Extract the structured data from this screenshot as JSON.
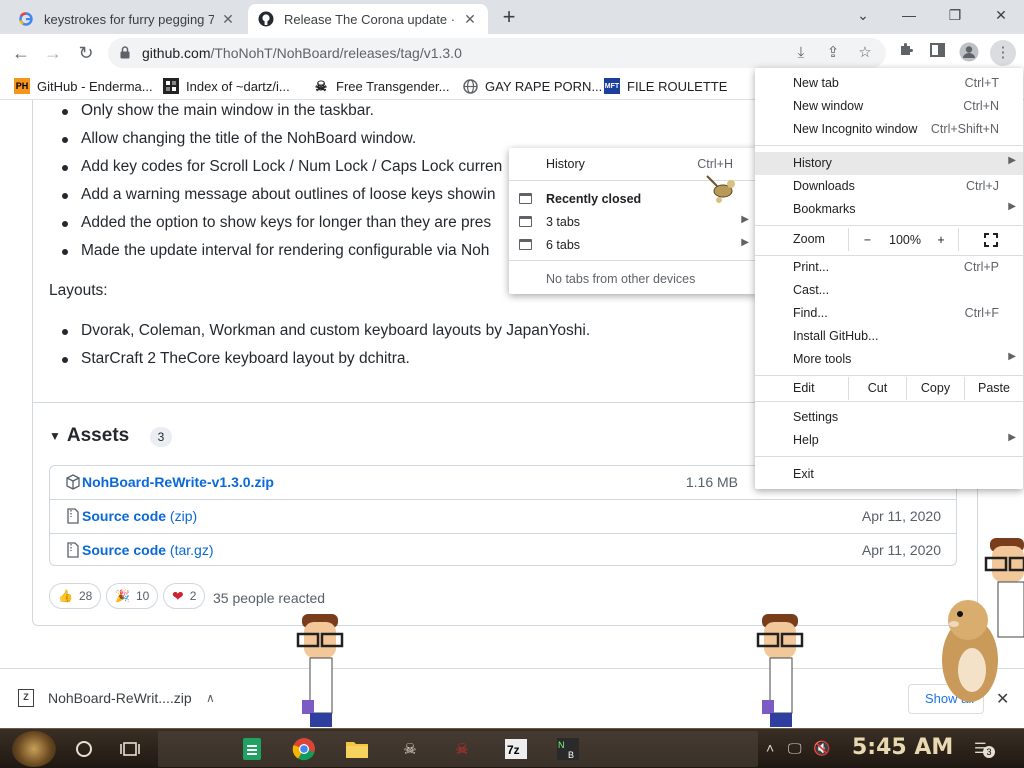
{
  "browser": {
    "tabs": [
      {
        "title": "keystrokes for furry pegging 7",
        "favicon": "google-icon"
      },
      {
        "title": "Release The Corona update · Th",
        "favicon": "github-icon"
      }
    ],
    "new_tab_symbol": "+",
    "window_controls": {
      "minimize": "⌄",
      "minimize2": "—",
      "restore": "❐",
      "close": "✕"
    },
    "url_host": "github.com",
    "url_path": "/ThoNohT/NohBoard/releases/tag/v1.3.0"
  },
  "bookmarks": [
    {
      "label": "GitHub - Enderma...",
      "icon": "PH"
    },
    {
      "label": "Index of ~dartz/i...",
      "icon": "pixel-icon"
    },
    {
      "label": "Free Transgender...",
      "icon": "skull-icon"
    },
    {
      "label": "GAY RAPE PORN...",
      "icon": "globe-icon"
    },
    {
      "label": "FILE ROULETTE",
      "icon": "MFT"
    }
  ],
  "release": {
    "bullets_top": [
      "Only show the main window in the taskbar.",
      "Allow changing the title of the NohBoard window.",
      "Add key codes for Scroll Lock / Num Lock / Caps Lock curren",
      "Add a warning message about outlines of loose keys showin",
      "Added the option to show keys for longer than they are pres",
      "Made the update interval for rendering configurable via Noh"
    ],
    "layouts_heading": "Layouts:",
    "bullets_layouts": [
      "Dvorak, Coleman, Workman and custom keyboard layouts by JapanYoshi.",
      "StarCraft 2 TheCore keyboard layout by dchitra."
    ]
  },
  "assets": {
    "heading": "Assets",
    "count": "3",
    "items": [
      {
        "name": "NohBoard-ReWrite-v1.3.0.zip",
        "suffix": "",
        "meta": "1.16 MB"
      },
      {
        "name": "Source code",
        "suffix": "(zip)",
        "meta": "Apr 11, 2020"
      },
      {
        "name": "Source code",
        "suffix": "(tar.gz)",
        "meta": "Apr 11, 2020"
      }
    ]
  },
  "reactions": [
    {
      "emoji": "👍",
      "count": "28"
    },
    {
      "emoji": "🎉",
      "count": "10"
    },
    {
      "emoji": "❤",
      "count": "2"
    }
  ],
  "reactions_summary": "35 people reacted",
  "chrome_menu": {
    "new_tab": {
      "label": "New tab",
      "shortcut": "Ctrl+T"
    },
    "new_window": {
      "label": "New window",
      "shortcut": "Ctrl+N"
    },
    "new_incognito": {
      "label": "New Incognito window",
      "shortcut": "Ctrl+Shift+N"
    },
    "history": {
      "label": "History"
    },
    "downloads": {
      "label": "Downloads",
      "shortcut": "Ctrl+J"
    },
    "bookmarks": {
      "label": "Bookmarks"
    },
    "zoom": {
      "label": "Zoom",
      "minus": "−",
      "value": "100%",
      "plus": "+"
    },
    "print": {
      "label": "Print...",
      "shortcut": "Ctrl+P"
    },
    "cast": {
      "label": "Cast..."
    },
    "find": {
      "label": "Find...",
      "shortcut": "Ctrl+F"
    },
    "install": {
      "label": "Install GitHub..."
    },
    "more_tools": {
      "label": "More tools"
    },
    "edit": {
      "label": "Edit",
      "cut": "Cut",
      "copy": "Copy",
      "paste": "Paste"
    },
    "settings": {
      "label": "Settings"
    },
    "help": {
      "label": "Help"
    },
    "exit": {
      "label": "Exit"
    }
  },
  "history_submenu": {
    "history": {
      "label": "History",
      "shortcut": "Ctrl+H"
    },
    "recently_closed": "Recently closed",
    "three_tabs": "3 tabs",
    "six_tabs": "6 tabs",
    "no_tabs": "No tabs from other devices"
  },
  "download_bar": {
    "file": "NohBoard-ReWrit....zip",
    "show_all": "Show all"
  },
  "taskbar": {
    "clock": "5:45 AM",
    "notification_count": "3"
  },
  "colors": {
    "link": "#0969da",
    "menu_highlight": "#e8e8e9",
    "heart": "#cf222e"
  }
}
